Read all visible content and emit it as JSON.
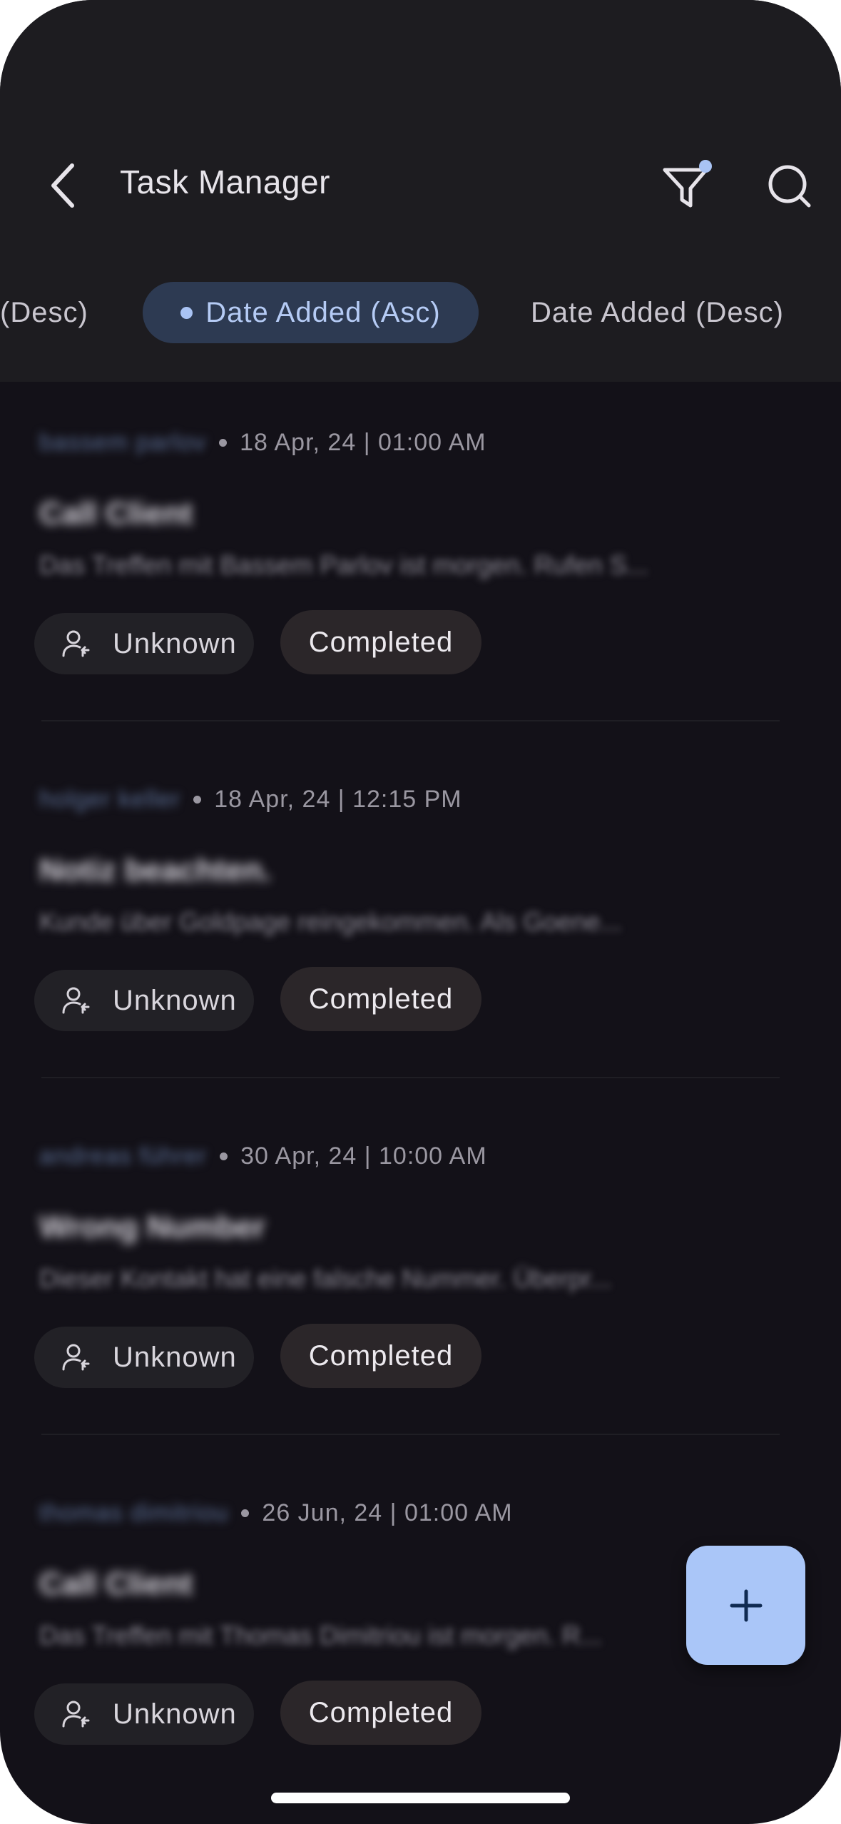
{
  "header": {
    "title": "Task Manager",
    "filter_active": true
  },
  "sort": {
    "left_partial": "(Desc)",
    "active": "Date Added (Asc)",
    "right": "Date Added (Desc)"
  },
  "tasks": [
    {
      "user": "bassem parlov",
      "date": "18 Apr, 24 | 01:00 AM",
      "title": "Call Client",
      "description": "Das Treffen mit Bassem Parlov ist morgen. Rufen S...",
      "assignee": "Unknown",
      "status": "Completed"
    },
    {
      "user": "holger keller",
      "date": "18 Apr, 24 | 12:15 PM",
      "title": "Notiz beachten.",
      "description": "Kunde über Goldpage reingekommen. Als Goene...",
      "assignee": "Unknown",
      "status": "Completed"
    },
    {
      "user": "andreas führer",
      "date": "30 Apr, 24 | 10:00 AM",
      "title": "Wrong Number",
      "description": "Dieser Kontakt hat eine falsche Nummer. Überpr...",
      "assignee": "Unknown",
      "status": "Completed"
    },
    {
      "user": "thomas dimitriou",
      "date": "26 Jun, 24 | 01:00 AM",
      "title": "Call Client",
      "description": "Das Treffen mit Thomas Dimitriou ist morgen. R...",
      "assignee": "Unknown",
      "status": "Completed"
    }
  ],
  "fab": {
    "icon": "plus-icon"
  },
  "colors": {
    "background": "#131118",
    "topbar": "#1d1c20",
    "accent": "#aac6f8",
    "active_chip": "#2d3a52",
    "status_chip": "#2b2629",
    "assignee_chip": "#222126"
  }
}
